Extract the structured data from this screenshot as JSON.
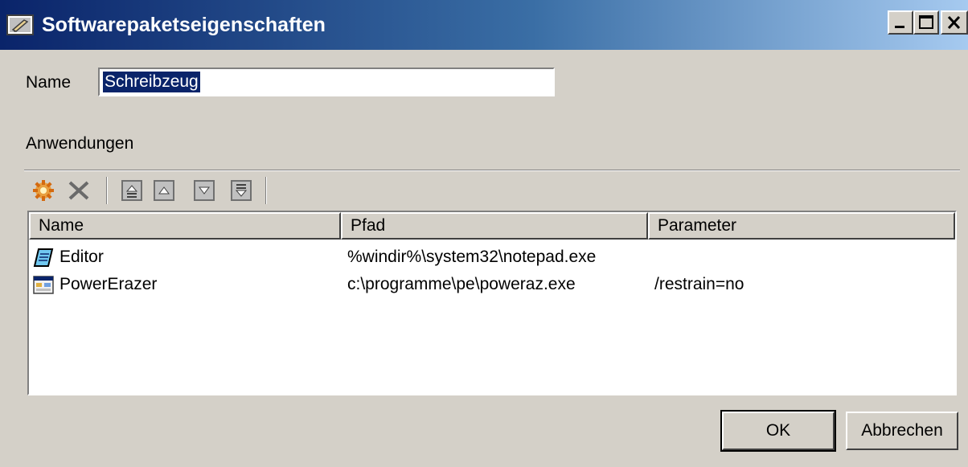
{
  "window": {
    "title": "Softwarepaketseigenschaften",
    "icons": {
      "app": "package-properties-icon",
      "minimize": "minimize-icon",
      "maximize": "maximize-icon",
      "close": "close-icon"
    }
  },
  "form": {
    "name_label": "Name",
    "name_value": "Schreibzeug",
    "applications_label": "Anwendungen"
  },
  "toolbar": {
    "icons": [
      "add-icon",
      "delete-icon",
      "move-top-icon",
      "move-up-icon",
      "move-down-icon",
      "move-bottom-icon"
    ]
  },
  "list": {
    "columns": [
      "Name",
      "Pfad",
      "Parameter"
    ],
    "rows": [
      {
        "name": "Editor",
        "path": "%windir%\\system32\\notepad.exe",
        "parameter": "",
        "icon": "notepad-icon"
      },
      {
        "name": "PowerErazer",
        "path": "c:\\programme\\pe\\poweraz.exe",
        "parameter": "/restrain=no",
        "icon": "application-icon"
      }
    ]
  },
  "buttons": {
    "ok": "OK",
    "cancel": "Abbrechen"
  }
}
